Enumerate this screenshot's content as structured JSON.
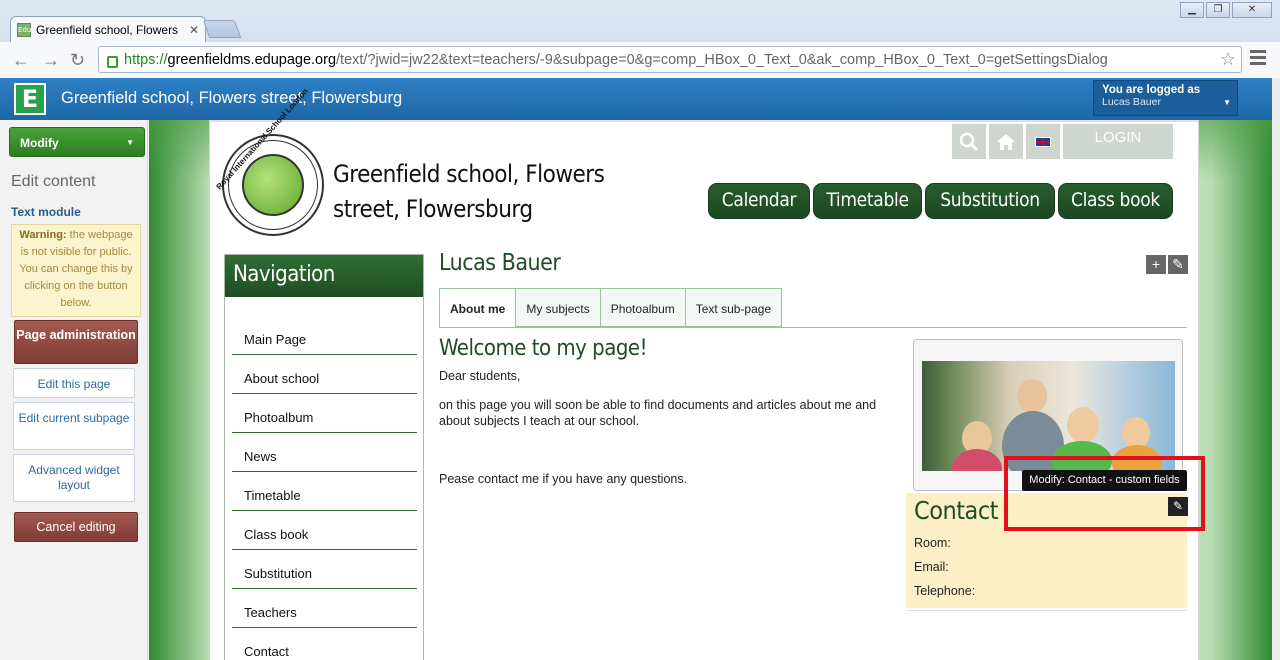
{
  "browser": {
    "tab_title": "Greenfield school, Flowers st",
    "favicon_text": "Edu",
    "url_scheme": "https://",
    "url_host": "greenfieldms.edupage.org",
    "url_rest": "/text/?jwid=jw22&text=teachers/-9&subpage=0&g=comp_HBox_0_Text_0&ak_comp_HBox_0_Text_0=getSettingsDialog"
  },
  "topbar": {
    "logo_letter": "E",
    "site_name": "Greenfield school, Flowers street, Flowersburg",
    "logged_label": "You are logged as",
    "user_name": "Lucas Bauer"
  },
  "edit_panel": {
    "modify_label": "Modify",
    "edit_content": "Edit content",
    "module_name": "Text module",
    "warning_strong": "Warning:",
    "warning_text": " the webpage is not visible for public. You can change this by clicking on the button below.",
    "page_admin_label": "Page administration",
    "edit_page_label": "Edit this page",
    "edit_subpage_label": "Edit current subpage",
    "advanced_layout_label": "Advanced widget layout",
    "cancel_label": "Cancel editing"
  },
  "header": {
    "seal_text": "Royal International School London",
    "school_title": "Greenfield school, Flowers street, Flowersburg",
    "login_label": "LOGIN",
    "main_nav": [
      "Calendar",
      "Timetable",
      "Substitution",
      "Class book"
    ]
  },
  "navigation": {
    "title": "Navigation",
    "items": [
      "Main Page",
      "About school",
      "Photoalbum",
      "News",
      "Timetable",
      "Class book",
      "Substitution",
      "Teachers",
      "Contact"
    ]
  },
  "content": {
    "person_name": "Lucas Bauer",
    "tabs": [
      "About me",
      "My subjects",
      "Photoalbum",
      "Text sub-page"
    ],
    "welcome": "Welcome to my page!",
    "greeting": "Dear students,",
    "para1": "on this page you will soon be able to find documents and articles about me and about subjects I teach at our school.",
    "para2": "Pease contact me if you have any questions."
  },
  "contact": {
    "title": "Contact",
    "room_label": "Room:",
    "email_label": "Email:",
    "phone_label": "Telephone:",
    "tooltip": "Modify: Contact - custom fields"
  },
  "colors": {
    "accent_green": "#1f4d25",
    "topbar_blue": "#2f80c5",
    "highlight_red": "#e0101c",
    "contact_bg": "#fdf0c6"
  }
}
